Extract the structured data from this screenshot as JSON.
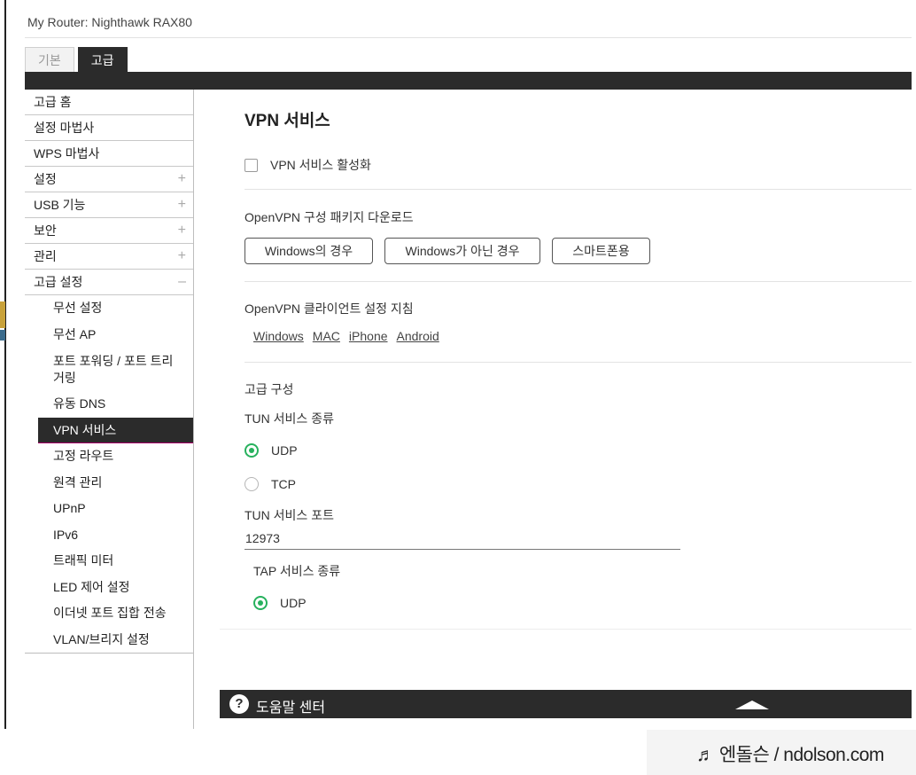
{
  "window": {
    "title": "My Router: Nighthawk RAX80"
  },
  "tabs": [
    {
      "label": "기본",
      "active": false
    },
    {
      "label": "고급",
      "active": true
    }
  ],
  "sidebar": {
    "items": [
      {
        "label": "고급 홈",
        "toggle": ""
      },
      {
        "label": "설정 마법사",
        "toggle": ""
      },
      {
        "label": "WPS 마법사",
        "toggle": ""
      },
      {
        "label": "설정",
        "toggle": "+"
      },
      {
        "label": "USB 기능",
        "toggle": "+"
      },
      {
        "label": "보안",
        "toggle": "+"
      },
      {
        "label": "관리",
        "toggle": "+"
      },
      {
        "label": "고급 설정",
        "toggle": "–"
      }
    ],
    "subitems": [
      {
        "label": "무선 설정"
      },
      {
        "label": "무선 AP"
      },
      {
        "label": "포트 포워딩 / 포트 트리거링"
      },
      {
        "label": "유동 DNS"
      },
      {
        "label": "VPN 서비스",
        "active": true
      },
      {
        "label": "고정 라우트"
      },
      {
        "label": "원격 관리"
      },
      {
        "label": "UPnP"
      },
      {
        "label": "IPv6"
      },
      {
        "label": "트래픽 미터"
      },
      {
        "label": "LED 제어 설정"
      },
      {
        "label": "이더넷 포트 집합 전송"
      },
      {
        "label": "VLAN/브리지 설정"
      }
    ]
  },
  "main": {
    "title": "VPN 서비스",
    "enable_label": "VPN 서비스 활성화",
    "enable_checked": false,
    "download": {
      "label": "OpenVPN 구성 패키지 다운로드",
      "buttons": [
        "Windows의 경우",
        "Windows가 아닌 경우",
        "스마트폰용"
      ]
    },
    "guide": {
      "label": "OpenVPN 클라이언트 설정 지침",
      "links": [
        "Windows",
        "MAC",
        "iPhone",
        "Android"
      ]
    },
    "advanced": {
      "label": "고급 구성",
      "tun_type_label": "TUN 서비스 종류",
      "tun_options": [
        {
          "label": "UDP",
          "selected": true
        },
        {
          "label": "TCP",
          "selected": false
        }
      ],
      "tun_port_label": "TUN 서비스 포트",
      "tun_port_value": "12973",
      "tap_type_label": "TAP 서비스 종류",
      "tap_options": [
        {
          "label": "UDP",
          "selected": true
        }
      ]
    }
  },
  "help": {
    "label": "도움말 센터",
    "icon": "question-icon",
    "toggle_icon": "chevron-up-icon"
  },
  "watermark": "♬ 엔돌슨 / ndolson.com",
  "colors": {
    "dark": "#2b2b2b",
    "accent_green": "#27b15d",
    "active_border": "#a30066"
  }
}
